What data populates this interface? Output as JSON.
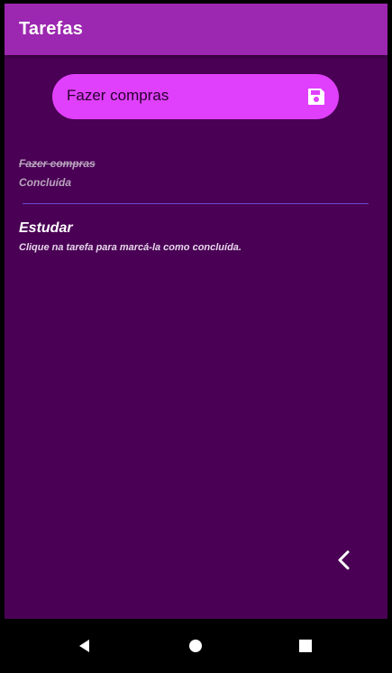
{
  "app_bar": {
    "title": "Tarefas",
    "color": "#9c27b0"
  },
  "input": {
    "value": "Fazer compras",
    "placeholder": "",
    "save_icon": "floppy-disk-icon",
    "background": "#e040fb"
  },
  "tasks": [
    {
      "title": "Fazer compras",
      "subtitle": "Concluída",
      "done": true
    },
    {
      "title": "Estudar",
      "subtitle": "Clique na tarefa para marcá-la como concluída.",
      "done": false
    }
  ],
  "screen_background": "#4a0055",
  "back_icon": "chevron-left-icon",
  "system_nav": {
    "back_icon": "triangle-back-icon",
    "home_icon": "circle-home-icon",
    "recents_icon": "square-recents-icon"
  }
}
